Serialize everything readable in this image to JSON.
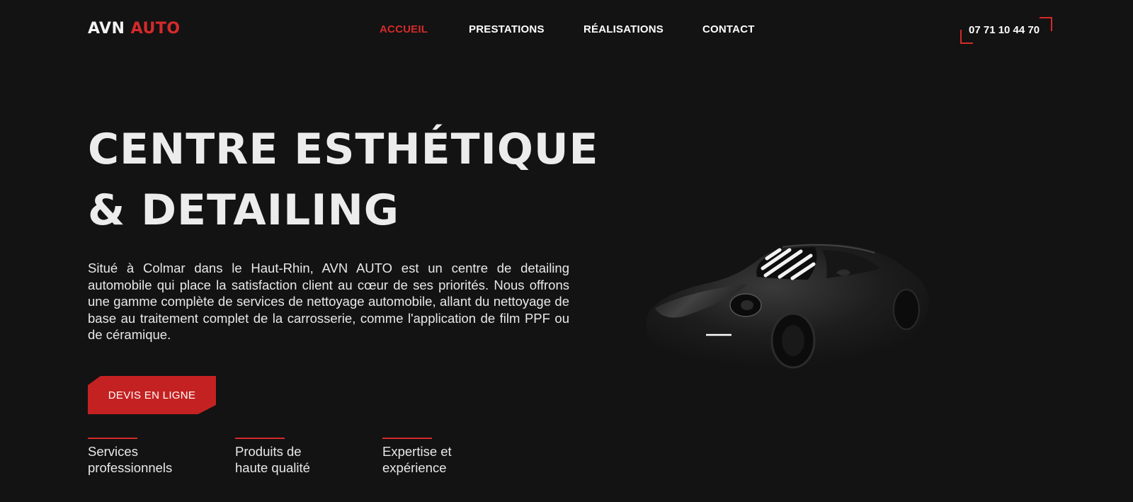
{
  "brand": {
    "name_part1": "AVN",
    "name_part2": "AUTO",
    "accent_color": "#d52a2a"
  },
  "nav": {
    "items": [
      {
        "label": "ACCUEIL",
        "active": true
      },
      {
        "label": "PRESTATIONS",
        "active": false
      },
      {
        "label": "RÉALISATIONS",
        "active": false
      },
      {
        "label": "CONTACT",
        "active": false
      }
    ]
  },
  "phone": "07 71 10 44 70",
  "hero": {
    "title_line1": "CENTRE ESTHÉTIQUE",
    "title_line2": "& DETAILING",
    "description": "Situé à Colmar dans le Haut-Rhin, AVN AUTO est un centre de detailing automobile qui place la satisfaction client au cœur de ses priorités. Nous offrons une gamme complète de services de nettoyage automobile, allant du nettoyage de base au traitement complet de la carrosserie, comme l'application de film PPF ou de céramique.",
    "cta_label": "DEVIS EN LIGNE"
  },
  "features": [
    {
      "line1": "Services",
      "line2": "professionnels"
    },
    {
      "line1": "Produits de",
      "line2": "haute qualité"
    },
    {
      "line1": "Expertise et",
      "line2": "expérience"
    }
  ],
  "image": {
    "icon": "sports-car-image"
  },
  "colors": {
    "background": "#131313",
    "accent": "#d52a2a",
    "cta_background": "#c42222",
    "text": "#ececec"
  }
}
